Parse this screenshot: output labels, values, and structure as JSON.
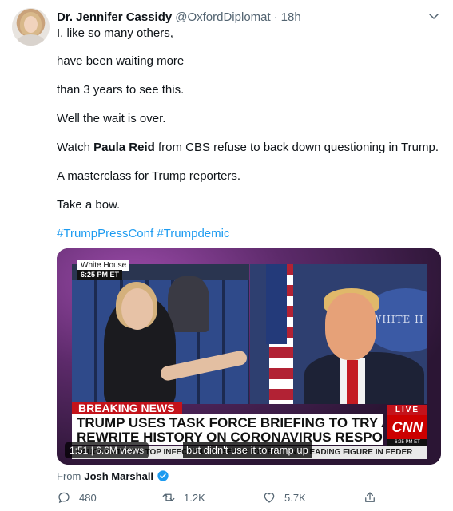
{
  "author": {
    "display_name": "Dr. Jennifer Cassidy",
    "handle": "@OxfordDiplomat",
    "separator": "·",
    "time": "18h"
  },
  "tweet": {
    "lines": [
      "I, like so many others,",
      "have been waiting more",
      "than 3 years to see this.",
      "Well the wait is over."
    ],
    "watch_prefix": "Watch ",
    "watch_name": "Paula Reid",
    "watch_suffix": " from CBS refuse to back down questioning in Trump.",
    "masterclass": "A masterclass for Trump reporters.",
    "bow": "Take a bow.",
    "hashtag_1": "#TrumpPressConf",
    "hashtag_2": "#Trumpdemic"
  },
  "media": {
    "location_tag": "White House",
    "time_tag": "6:25 PM ET",
    "breaking": "BREAKING NEWS",
    "headline_line1": "TRUMP USES TASK FORCE BRIEFING TO TRY AND",
    "headline_line2": "REWRITE HISTORY ON CORONAVIRUS RESPONSE",
    "live": "LIVE",
    "logo": "CNN",
    "cnn_time": "6:25 PM ET",
    "ticker": "FAUCI: NATION'S TOP INFECTIOUS DISEASE EXPERT AND LEADING FIGURE IN FEDER",
    "sign_text": "WHITE H",
    "duration": "1:51",
    "views": "6.6M views",
    "caption": "but didn't use it to ramp up"
  },
  "attribution": {
    "prefix": "From",
    "name": "Josh Marshall"
  },
  "actions": {
    "reply_count": "480",
    "retweet_count": "1.2K",
    "like_count": "5.7K"
  },
  "colors": {
    "link": "#1d9bf0",
    "secondary_text": "#536471",
    "breaking_red": "#c4131b",
    "verified_blue": "#1d9bf0"
  },
  "icons": [
    "avatar",
    "chevron-down-icon",
    "verified-badge-icon",
    "reply-icon",
    "retweet-icon",
    "like-icon",
    "share-icon"
  ]
}
